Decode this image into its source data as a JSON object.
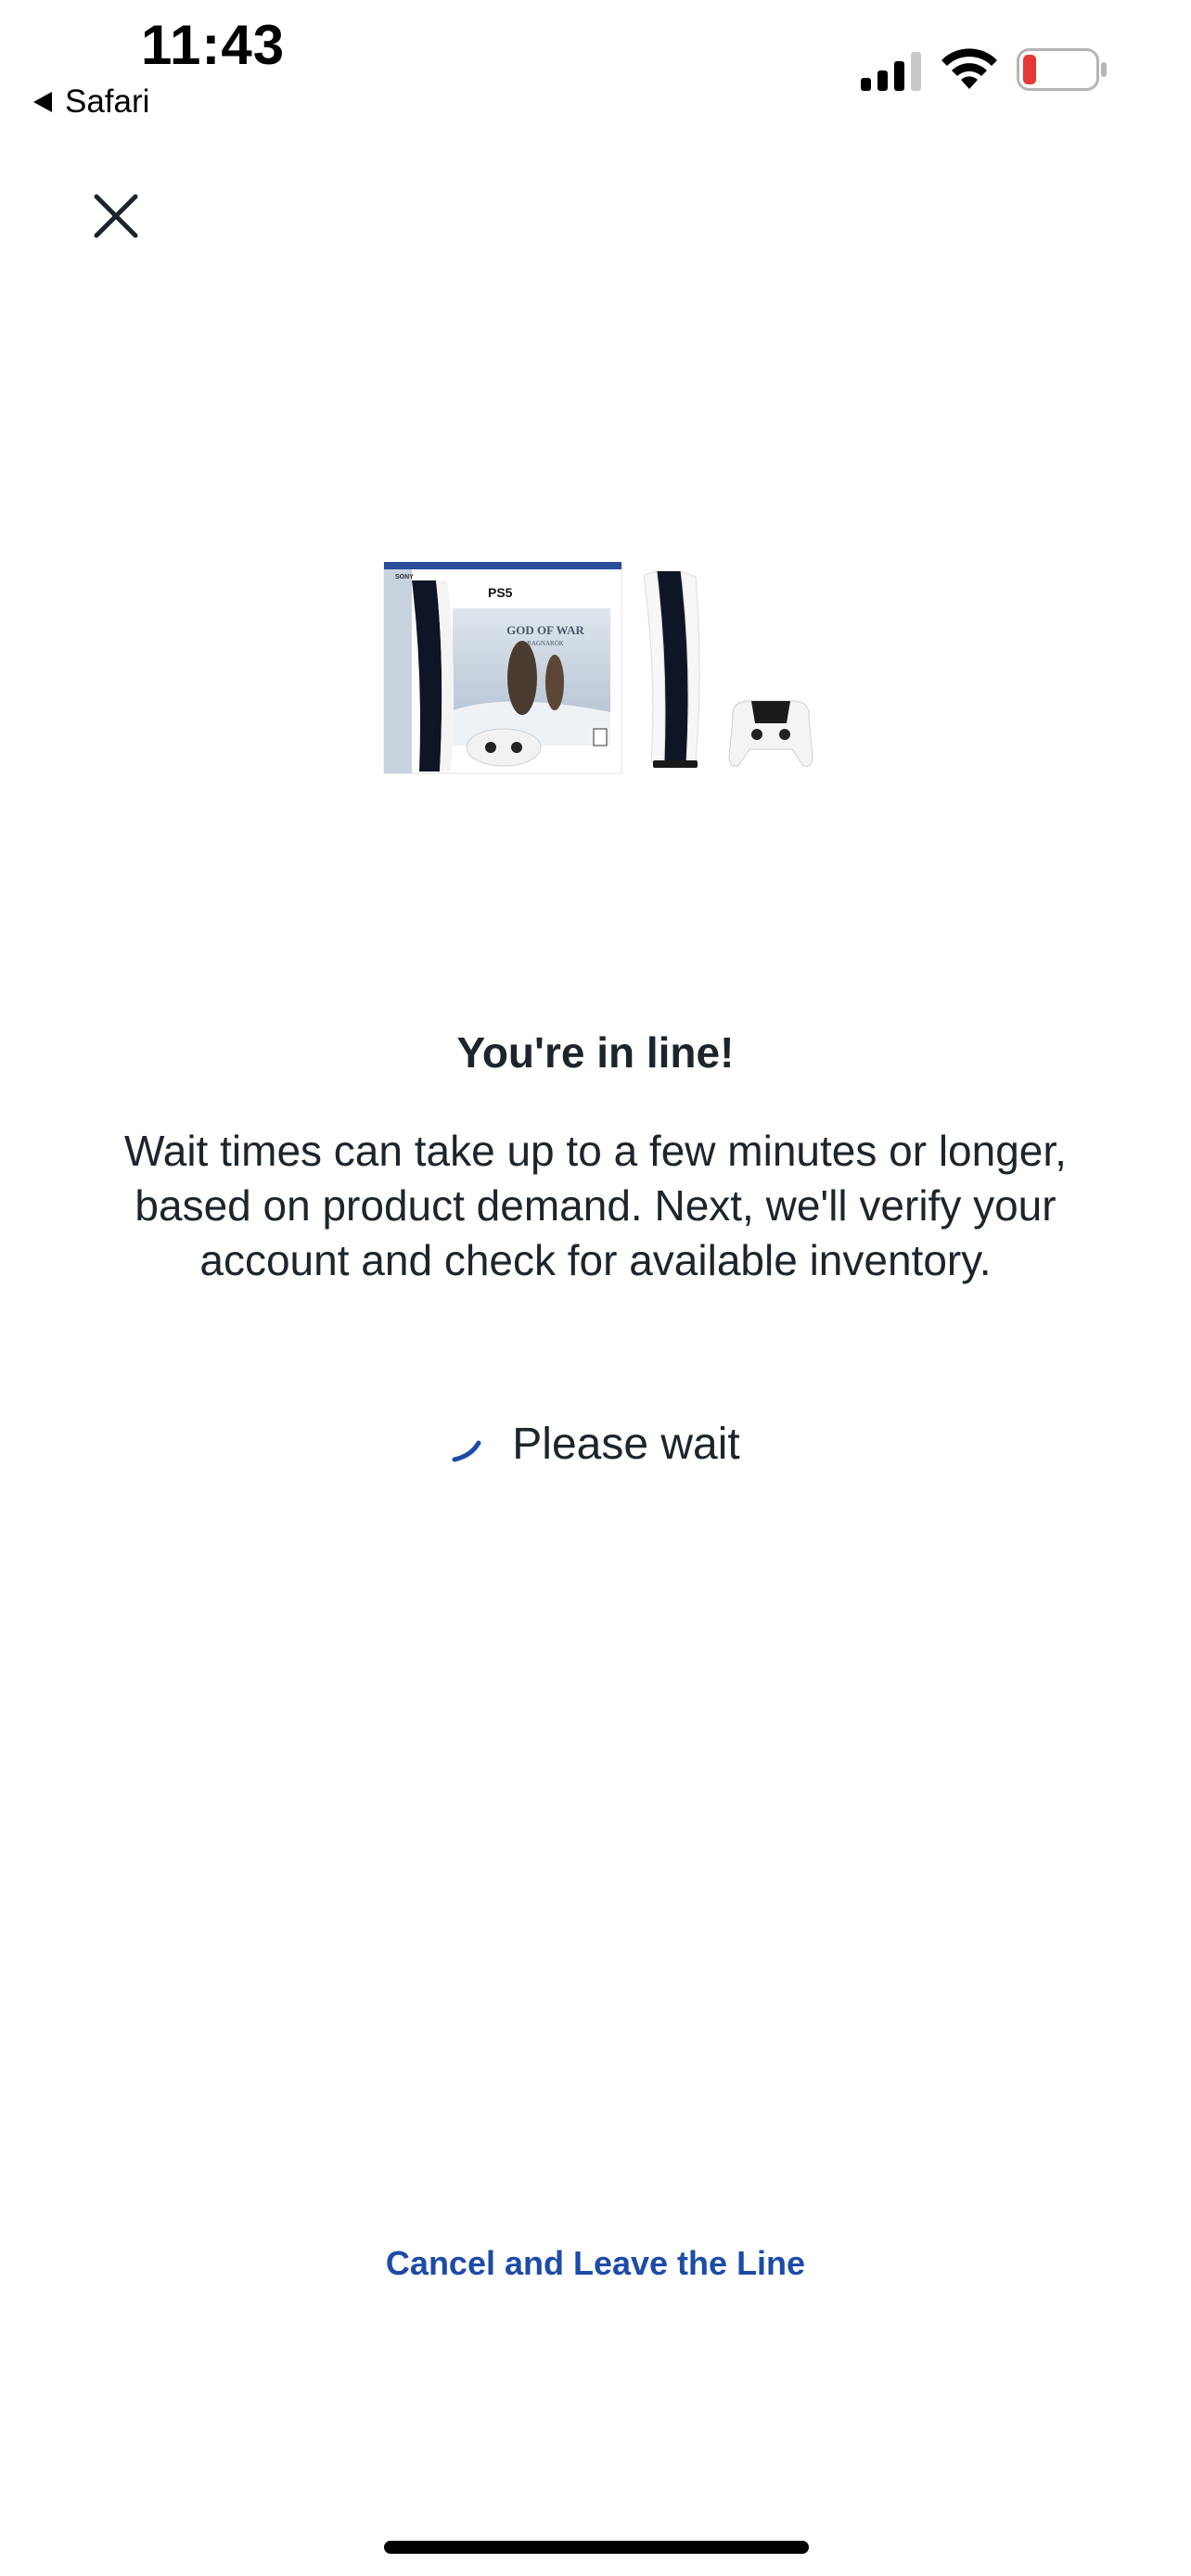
{
  "status_bar": {
    "time": "11:43",
    "back_app_label": "Safari",
    "signal_icon": "cellular-signal-icon",
    "wifi_icon": "wifi-icon",
    "battery_icon": "battery-low-icon",
    "battery_color": "#e53935"
  },
  "close_icon": "close-icon",
  "product": {
    "box_brand": "SONY",
    "box_logo": "PS5",
    "box_game_title": "GOD OF WAR",
    "box_game_subtitle": "RAGNARÖK"
  },
  "queue": {
    "headline": "You're in line!",
    "message": "Wait times can take up to a few minutes or longer, based on product demand. Next, we'll verify your account and check for available inventory.",
    "status_label": "Please wait",
    "spinner_icon": "loading-spinner-icon",
    "spinner_color": "#1d4ba8"
  },
  "actions": {
    "cancel_label": "Cancel and Leave the Line",
    "link_color": "#1d4ba8"
  }
}
